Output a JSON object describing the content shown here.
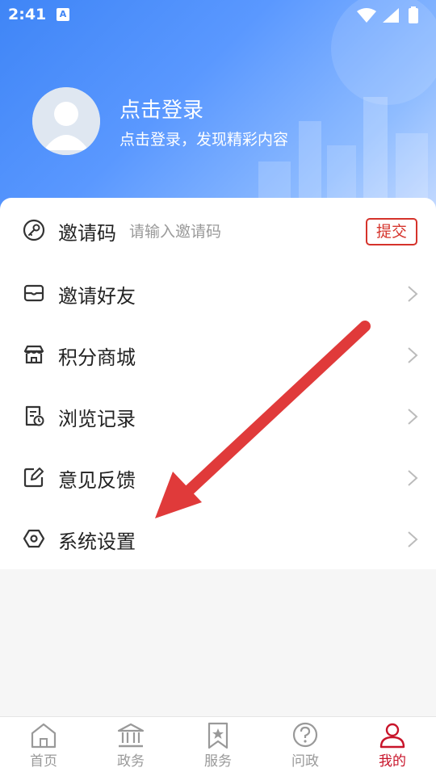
{
  "status_bar": {
    "time": "2:41",
    "notif_icon": "A"
  },
  "profile": {
    "title": "点击登录",
    "subtitle": "点击登录，发现精彩内容"
  },
  "menu": {
    "invite_code": {
      "label": "邀请码",
      "placeholder": "请输入邀请码",
      "value": "",
      "submit": "提交"
    },
    "items": [
      {
        "label": "邀请好友",
        "icon": "mail-icon"
      },
      {
        "label": "积分商城",
        "icon": "store-icon"
      },
      {
        "label": "浏览记录",
        "icon": "history-icon"
      },
      {
        "label": "意见反馈",
        "icon": "edit-icon"
      },
      {
        "label": "系统设置",
        "icon": "settings-icon"
      }
    ]
  },
  "bottom_nav": {
    "items": [
      {
        "label": "首页",
        "icon": "home-icon"
      },
      {
        "label": "政务",
        "icon": "government-icon"
      },
      {
        "label": "服务",
        "icon": "bookmark-star-icon"
      },
      {
        "label": "问政",
        "icon": "question-icon"
      },
      {
        "label": "我的",
        "icon": "user-icon"
      }
    ],
    "active_index": 4
  },
  "colors": {
    "accent": "#d5332b",
    "active_nav": "#c8142a",
    "header_blue": "#3f85f6",
    "annotation_arrow": "#e03a3a"
  }
}
